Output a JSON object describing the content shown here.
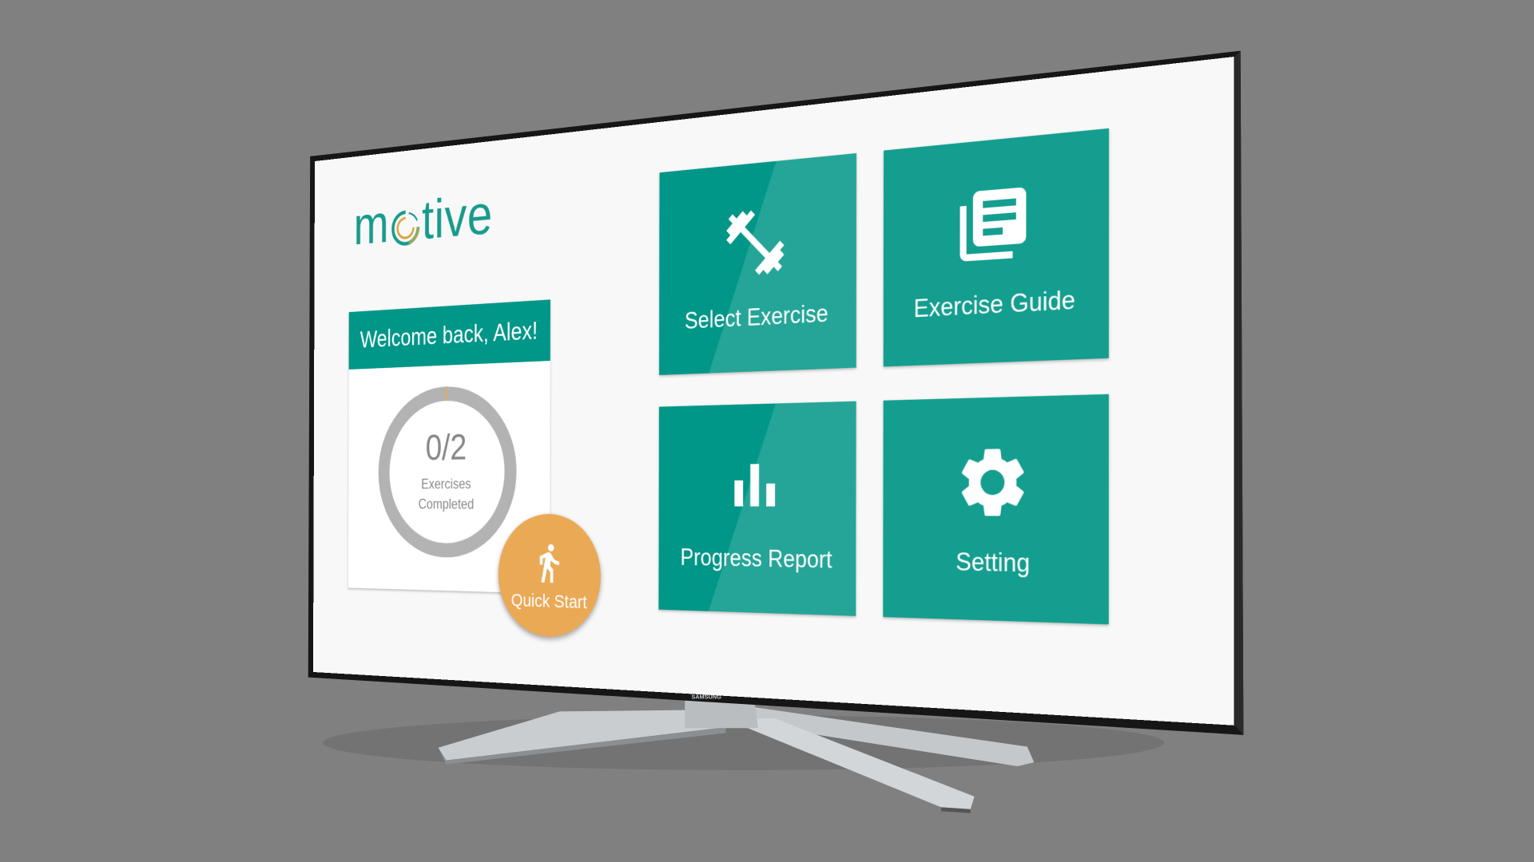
{
  "app": {
    "logo_text": "motive",
    "logo_prefix": "m",
    "logo_suffix": "tive"
  },
  "tv": {
    "brand": "SAMSUNG"
  },
  "welcome_card": {
    "title": "Welcome back, Alex!",
    "progress": {
      "completed": 0,
      "total": 2,
      "text": "0/2",
      "label_line1": "Exercises",
      "label_line2": "Completed"
    }
  },
  "quick_start": {
    "label": "Quick Start",
    "icon": "running-person-icon"
  },
  "tiles": [
    {
      "label": "Select Exercise",
      "icon": "dumbbell-icon"
    },
    {
      "label": "Exercise Guide",
      "icon": "guide-document-icon"
    },
    {
      "label": "Progress Report",
      "icon": "bar-chart-icon"
    },
    {
      "label": "Setting",
      "icon": "gear-icon"
    }
  ],
  "colors": {
    "teal": "#009688",
    "tile": "#149e8f",
    "accent_orange": "#eaa955",
    "ring_gray": "#b3b3b3",
    "background": "#808080"
  }
}
